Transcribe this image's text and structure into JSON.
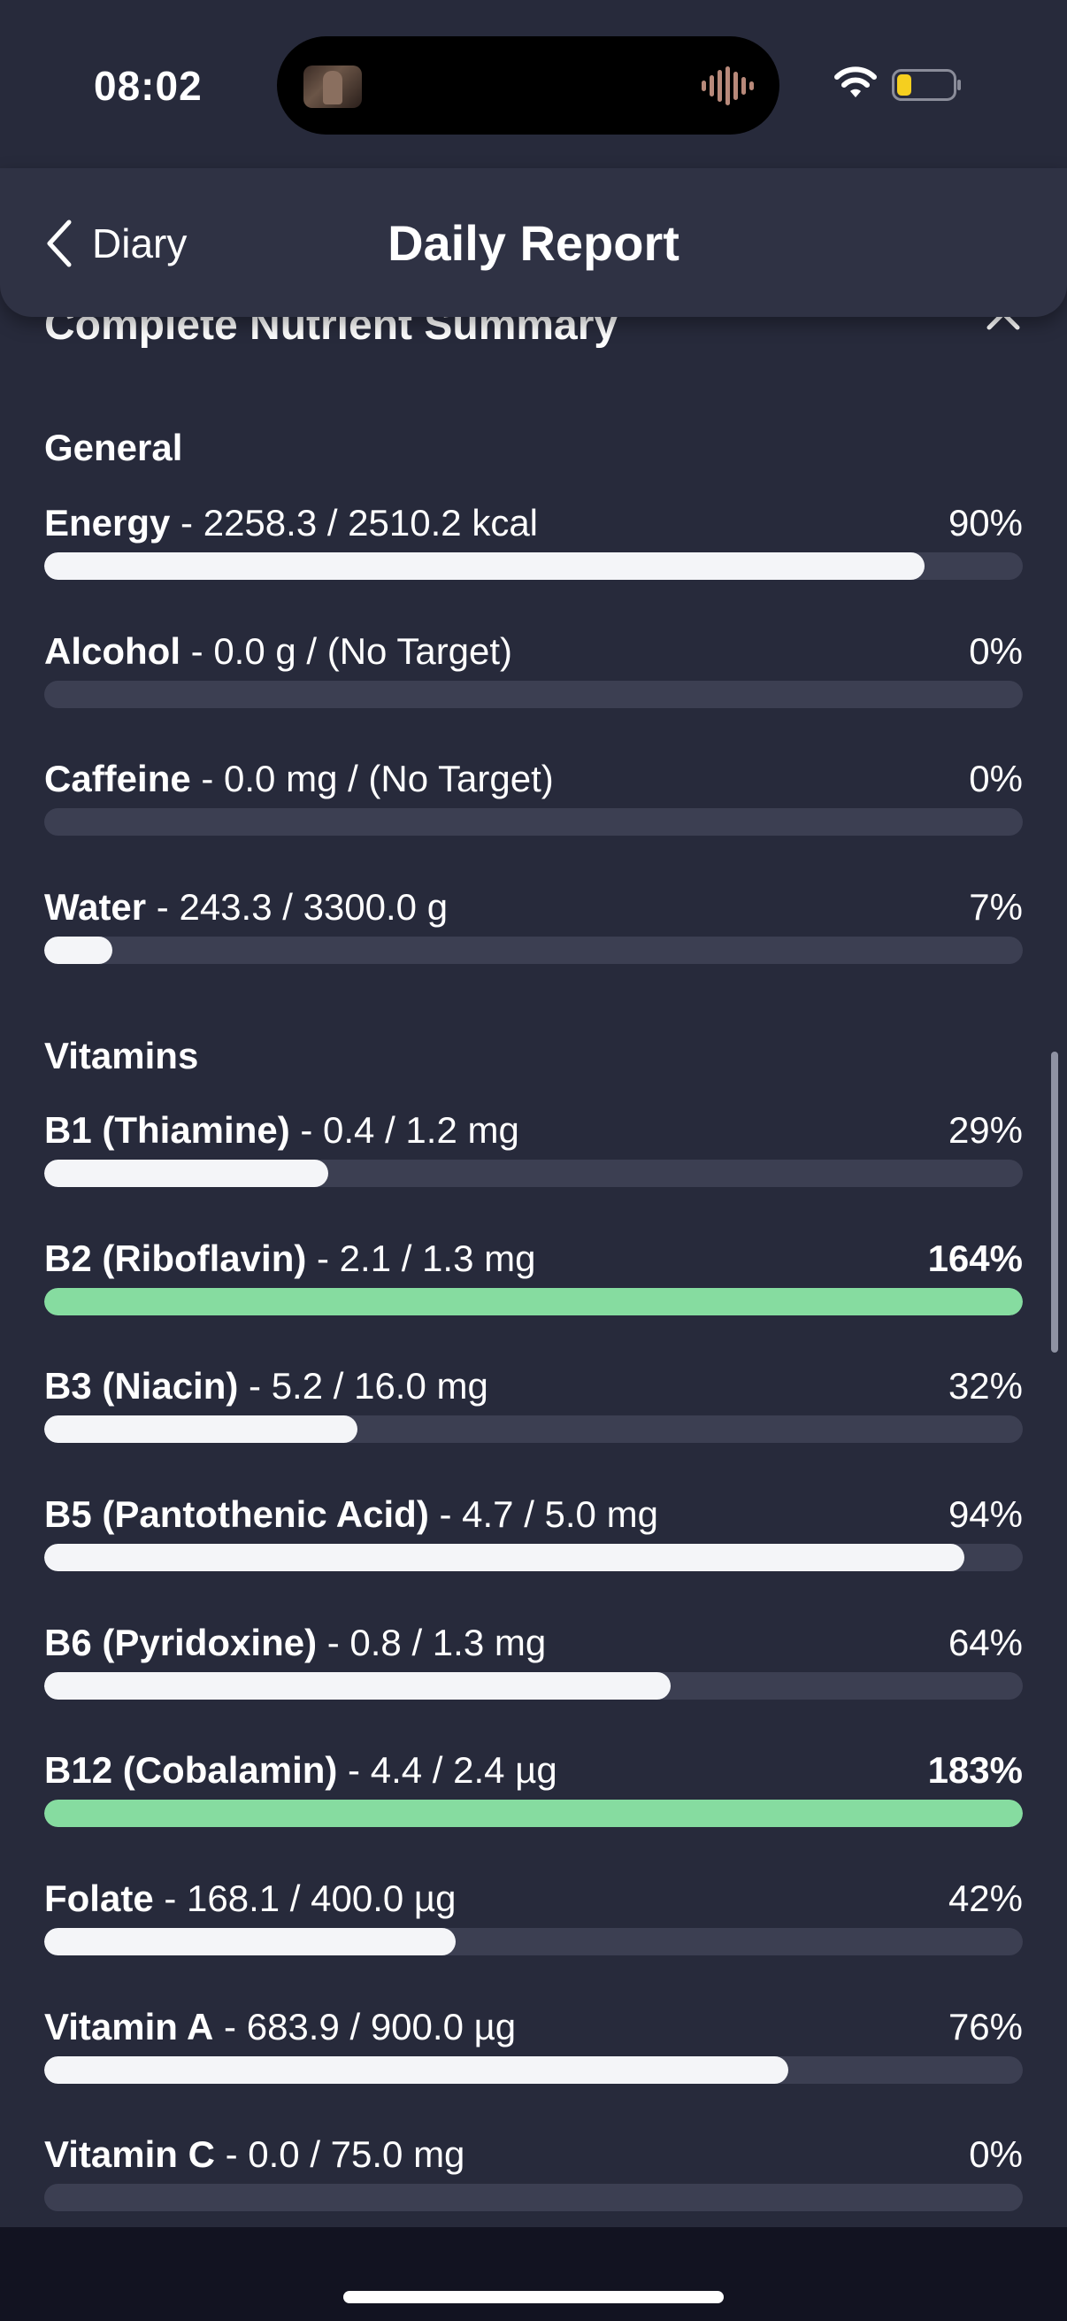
{
  "status_bar": {
    "time": "08:02"
  },
  "header": {
    "back_label": "Diary",
    "title": "Daily Report"
  },
  "summary": {
    "title": "Complete Nutrient Summary",
    "groups": [
      {
        "title": "General",
        "rows": [
          {
            "name": "Energy",
            "detail": " - 2258.3 / 2510.2 kcal",
            "percent": "90%",
            "fill": 0.9,
            "over": false
          },
          {
            "name": "Alcohol",
            "detail": " - 0.0 g / (No Target)",
            "percent": "0%",
            "fill": 0.0,
            "over": false
          },
          {
            "name": "Caffeine",
            "detail": " - 0.0 mg / (No Target)",
            "percent": "0%",
            "fill": 0.0,
            "over": false
          },
          {
            "name": "Water",
            "detail": " - 243.3 / 3300.0 g",
            "percent": "7%",
            "fill": 0.07,
            "over": false
          }
        ]
      },
      {
        "title": "Vitamins",
        "rows": [
          {
            "name": "B1 (Thiamine)",
            "detail": " - 0.4 / 1.2 mg",
            "percent": "29%",
            "fill": 0.29,
            "over": false
          },
          {
            "name": "B2 (Riboflavin)",
            "detail": " - 2.1 / 1.3 mg",
            "percent": "164%",
            "fill": 1.0,
            "over": true
          },
          {
            "name": "B3 (Niacin)",
            "detail": " - 5.2 / 16.0 mg",
            "percent": "32%",
            "fill": 0.32,
            "over": false
          },
          {
            "name": "B5 (Pantothenic Acid)",
            "detail": " - 4.7 / 5.0 mg",
            "percent": "94%",
            "fill": 0.94,
            "over": false
          },
          {
            "name": "B6 (Pyridoxine)",
            "detail": " - 0.8 / 1.3 mg",
            "percent": "64%",
            "fill": 0.64,
            "over": false
          },
          {
            "name": "B12 (Cobalamin)",
            "detail": " - 4.4 / 2.4 µg",
            "percent": "183%",
            "fill": 1.0,
            "over": true
          },
          {
            "name": "Folate",
            "detail": " - 168.1 / 400.0 µg",
            "percent": "42%",
            "fill": 0.42,
            "over": false
          },
          {
            "name": "Vitamin A",
            "detail": " - 683.9 / 900.0 µg",
            "percent": "76%",
            "fill": 0.76,
            "over": false
          },
          {
            "name": "Vitamin C",
            "detail": " - 0.0 / 75.0 mg",
            "percent": "0%",
            "fill": 0.0,
            "over": false
          }
        ]
      }
    ]
  },
  "colors": {
    "background": "#272a3b",
    "track": "#3c3f52",
    "fill_normal": "#f4f5f8",
    "fill_over": "#86dca0"
  },
  "icons": [
    "wifi-icon",
    "battery-icon",
    "back-chevron-icon",
    "chevron-up-icon",
    "audio-waveform-icon"
  ]
}
